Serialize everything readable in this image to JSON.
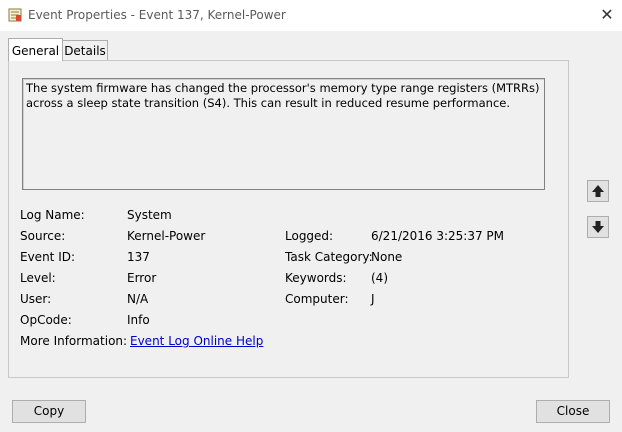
{
  "window": {
    "title": "Event Properties - Event 137, Kernel-Power",
    "close_glyph": "✕"
  },
  "tabs": [
    {
      "label": "General",
      "active": true
    },
    {
      "label": "Details",
      "active": false
    }
  ],
  "event": {
    "description": "The system firmware has changed the processor's memory type range registers (MTRRs) across a sleep state transition (S4). This can result in reduced resume performance.",
    "left": [
      {
        "label": "Log Name:",
        "value": "System"
      },
      {
        "label": "Source:",
        "value": "Kernel-Power"
      },
      {
        "label": "Event ID:",
        "value": "137"
      },
      {
        "label": "Level:",
        "value": "Error"
      },
      {
        "label": "User:",
        "value": "N/A"
      },
      {
        "label": "OpCode:",
        "value": "Info"
      },
      {
        "label": "More Information:",
        "value": "Event Log Online Help"
      }
    ],
    "right": [
      {
        "label": "Logged:",
        "value": "6/21/2016 3:25:37 PM"
      },
      {
        "label": "Task Category:",
        "value": "None"
      },
      {
        "label": "Keywords:",
        "value": "(4)"
      },
      {
        "label": "Computer:",
        "value": "J"
      }
    ]
  },
  "buttons": {
    "copy": "Copy",
    "close": "Close"
  },
  "icons": {
    "app": "event-properties-icon",
    "up": "up-arrow-icon",
    "down": "down-arrow-icon"
  }
}
